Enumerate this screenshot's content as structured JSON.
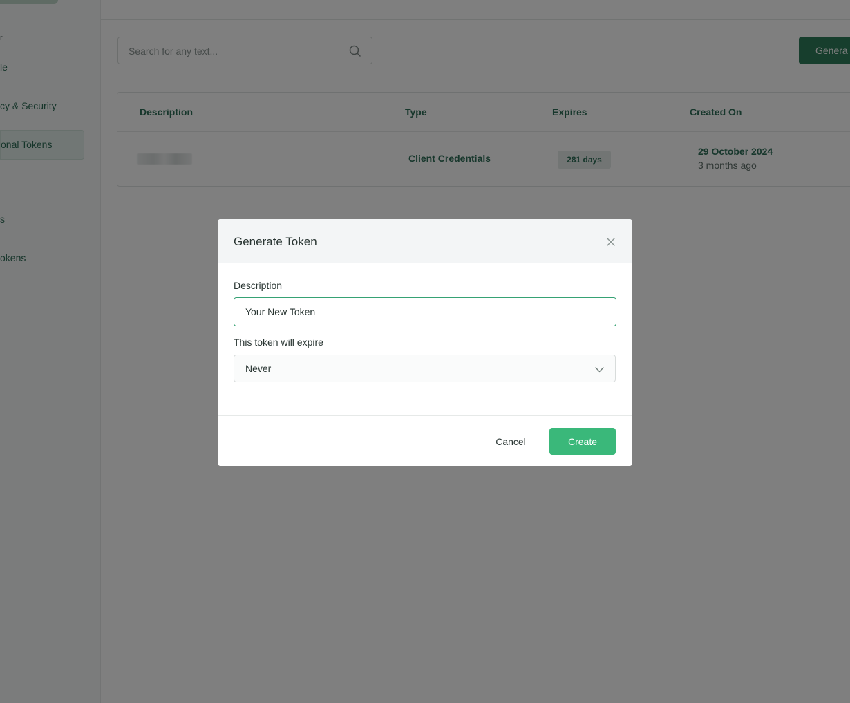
{
  "sidebar": {
    "section_label": "r",
    "items": [
      {
        "label": "le"
      },
      {
        "label": "cy & Security"
      },
      {
        "label": "onal Tokens"
      },
      {
        "label": "s"
      },
      {
        "label": "okens"
      }
    ]
  },
  "search": {
    "placeholder": "Search for any text...",
    "icon": "search-icon"
  },
  "generate_button": {
    "label": "Genera"
  },
  "table": {
    "columns": [
      "Description",
      "Type",
      "Expires",
      "Created On"
    ],
    "rows": [
      {
        "description": "",
        "type": "Client Credentials",
        "expires": "281 days",
        "created_date": "29 October 2024",
        "created_relative": "3 months ago"
      }
    ]
  },
  "modal": {
    "title": "Generate Token",
    "close_icon": "close-icon",
    "description_label": "Description",
    "description_value": "Your New Token",
    "expire_label": "This token will expire",
    "expire_value": "Never",
    "cancel_label": "Cancel",
    "create_label": "Create"
  },
  "colors": {
    "primary_dark": "#2f7d5b",
    "primary": "#3ab87a",
    "focus_border": "#36a274",
    "text_green": "#2f6e58"
  }
}
